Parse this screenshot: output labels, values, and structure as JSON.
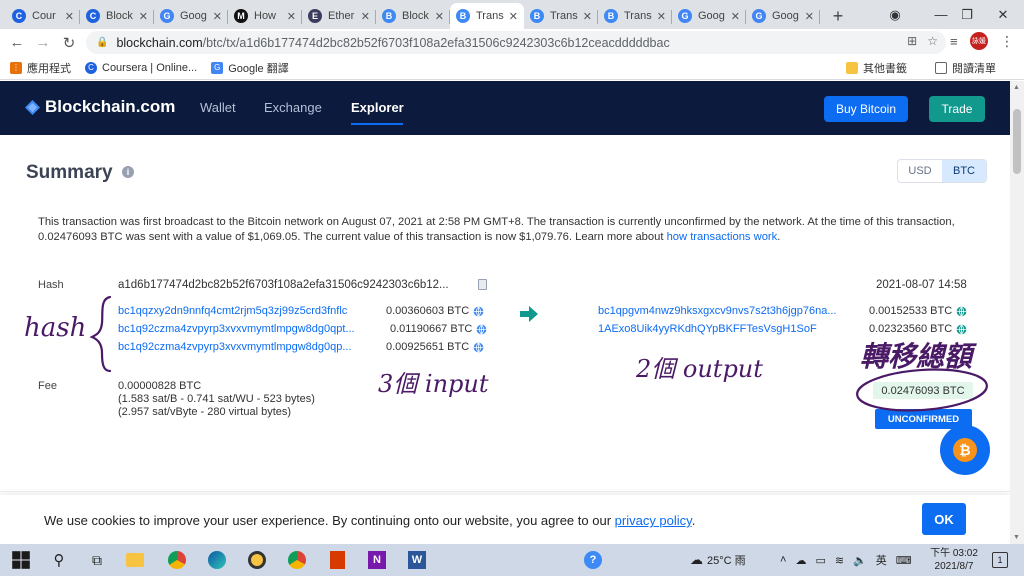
{
  "browser": {
    "tabs": [
      {
        "label": "Cour",
        "icon": "coursera-icon",
        "color": "#1f62e0",
        "glyph": "C"
      },
      {
        "label": "Block",
        "icon": "coursera-icon",
        "color": "#1f62e0",
        "glyph": "C"
      },
      {
        "label": "Goog",
        "icon": "google-translate-icon",
        "color": "#4285f4",
        "glyph": "G"
      },
      {
        "label": "How",
        "icon": "medium-icon",
        "color": "#111111",
        "glyph": "M"
      },
      {
        "label": "Ether",
        "icon": "ethereum-icon",
        "color": "#3c3c5e",
        "glyph": "E"
      },
      {
        "label": "Block",
        "icon": "blockchain-icon",
        "color": "#3d89f5",
        "glyph": "B"
      },
      {
        "label": "Trans",
        "icon": "blockchain-icon",
        "color": "#3d89f5",
        "glyph": "B"
      },
      {
        "label": "Trans",
        "icon": "blockchain-icon",
        "color": "#3d89f5",
        "glyph": "B"
      },
      {
        "label": "Trans",
        "icon": "blockchain-icon",
        "color": "#3d89f5",
        "glyph": "B"
      },
      {
        "label": "Goog",
        "icon": "google-translate-icon",
        "color": "#4285f4",
        "glyph": "G"
      },
      {
        "label": "Goog",
        "icon": "google-translate-icon",
        "color": "#4285f4",
        "glyph": "G"
      }
    ],
    "active_tab_index": 6,
    "url_host": "blockchain.com",
    "url_path": "/btc/tx/a1d6b177474d2bc82b52f6703f108a2efa31506c9242303c6b12ceacdddddbac",
    "profile_label": "詠媛",
    "bookmarks": [
      {
        "label": "應用程式",
        "icon": "apps-grid-icon"
      },
      {
        "label": "Coursera | Online...",
        "icon": "coursera-icon"
      },
      {
        "label": "Google 翻譯",
        "icon": "google-translate-icon"
      }
    ],
    "bookmarks_right": [
      {
        "label": "其他書籤",
        "icon": "folder-icon"
      },
      {
        "label": "閱讀清單",
        "icon": "reading-list-icon"
      }
    ]
  },
  "site": {
    "logo": "Blockchain.com",
    "nav": {
      "wallet": "Wallet",
      "exchange": "Exchange",
      "explorer": "Explorer"
    },
    "buy_bitcoin": "Buy Bitcoin",
    "trade": "Trade",
    "brand_color": "#0c6cf2",
    "header_color": "#0c1a3d",
    "trade_color": "#11998e"
  },
  "summary": {
    "title": "Summary",
    "currency_options": [
      "USD",
      "BTC"
    ],
    "currency_selected": "BTC",
    "description": "This transaction was first broadcast to the Bitcoin network on August 07, 2021 at 2:58 PM GMT+8.  The transaction is currently unconfirmed by the network.  At the time of this transaction, 0.02476093 BTC was sent with a value of $1,069.05. The current value of this transaction is now $1,079.76.  Learn more about ",
    "learn_more_link": "how transactions work",
    "description_end": "."
  },
  "tx": {
    "hash_label": "Hash",
    "hash_value": "a1d6b177474d2bc82b52f6703f108a2efa31506c9242303c6b12...",
    "timestamp": "2021-08-07 14:58",
    "inputs": [
      {
        "address": "bc1qqzxy2dn9nnfq4cmt2rjm5q3zj99z5crd3fnflc",
        "amount": "0.00360603 BTC"
      },
      {
        "address": "bc1q92czma4zvpyrp3xvxvmymtlmpgw8dg0qpt...",
        "amount": "0.01190667 BTC"
      },
      {
        "address": "bc1q92czma4zvpyrp3xvxvmymtlmpgw8dg0qp...",
        "amount": "0.00925651 BTC"
      }
    ],
    "outputs": [
      {
        "address": "bc1qpgvm4nwz9hksxgxcv9nvs7s2t3h6jgp76na...",
        "amount": "0.00152533 BTC"
      },
      {
        "address": "1AExo8Uik4yyRKdhQYpBKFFTesVsgH1SoF",
        "amount": "0.02323560 BTC"
      }
    ],
    "fee_label": "Fee",
    "fee_lines": [
      "0.00000828 BTC",
      "(1.583 sat/B - 0.741 sat/WU - 523 bytes)",
      "(2.957 sat/vByte - 280 virtual bytes)"
    ],
    "total": "0.02476093 BTC",
    "status": "UNCONFIRMED"
  },
  "annotations": {
    "hash_note": "hash",
    "inputs_note": "3個 input",
    "outputs_note": "2個 output",
    "total_note": "轉移總額",
    "ink_color": "#4b1a66"
  },
  "cookie": {
    "text": "We use cookies to improve your user experience. By continuing onto our website, you agree to our ",
    "link": "privacy policy",
    "end": ".",
    "ok": "OK"
  },
  "taskbar": {
    "weather": "25°C 雨",
    "ime": "英",
    "time": "下午 03:02",
    "date": "2021/8/7",
    "notifications": "1"
  }
}
